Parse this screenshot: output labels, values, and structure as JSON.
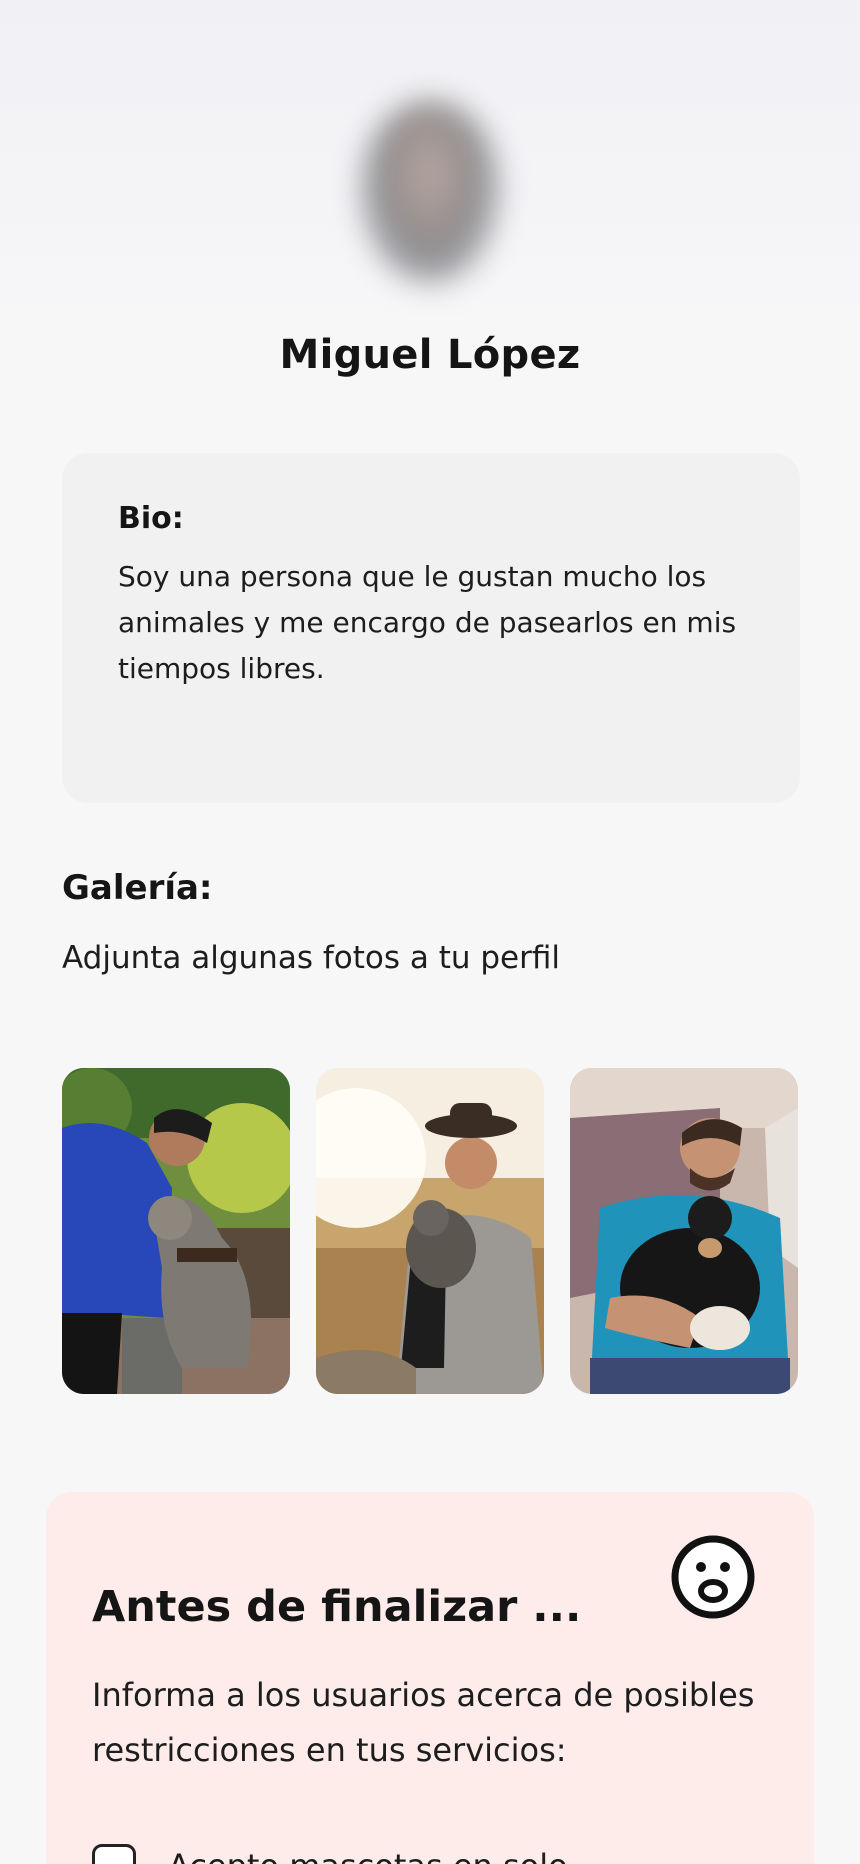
{
  "profile": {
    "name": "Miguel López"
  },
  "bio": {
    "label": "Bio:",
    "text": "Soy una persona que le gustan mucho los animales y me encargo de pasearlos en mis tiempos libres."
  },
  "gallery": {
    "title": "Galería:",
    "subtitle": "Adjunta algunas fotos a tu perfil",
    "photos": [
      "person-with-dog-photo",
      "person-with-cat-photo",
      "person-hugging-dog-photo"
    ]
  },
  "notice": {
    "title": "Antes de finalizar ...",
    "text": "Informa a los usuarios acerca de posibles restricciones en tus servicios:",
    "icon": "surprised-face-icon",
    "options": [
      {
        "label": "Acepto mascotas en solo",
        "checked": false
      }
    ]
  },
  "colors": {
    "notice_bg": "#fdecea",
    "card_bg": "#f1f1f2",
    "page_bg": "#f7f7f8"
  }
}
